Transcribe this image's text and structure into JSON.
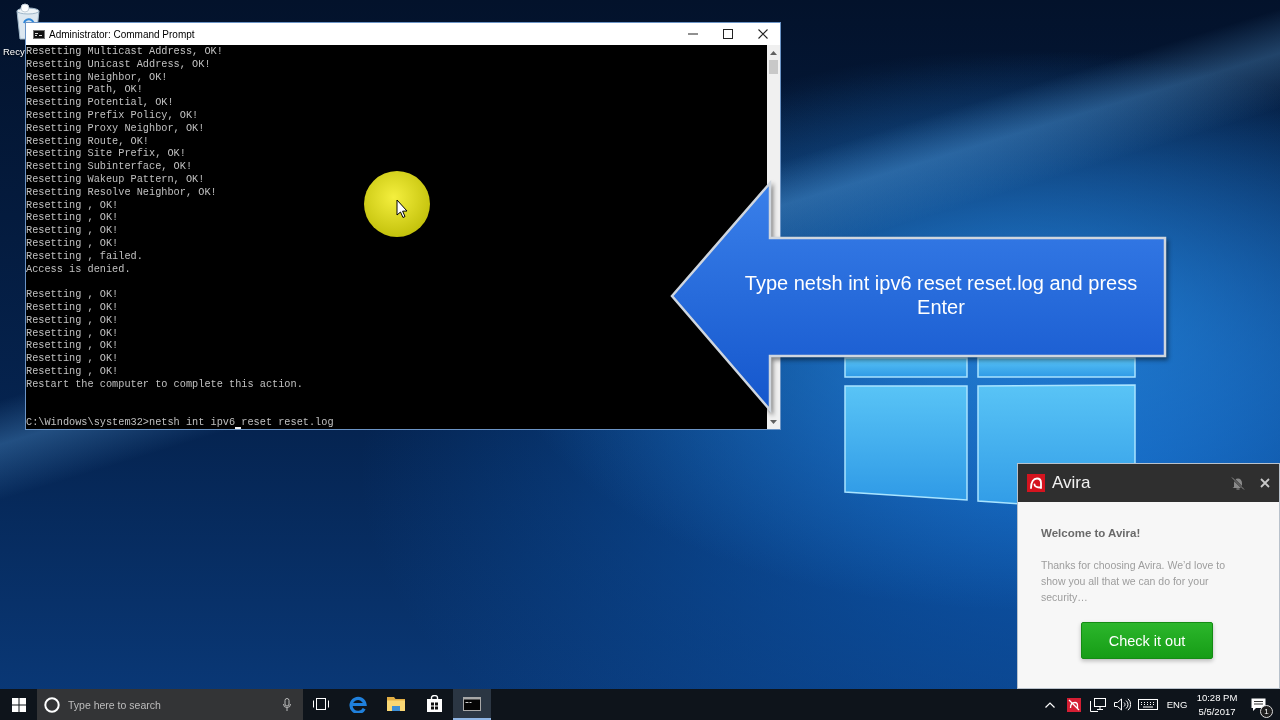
{
  "desktop": {
    "icons": [
      {
        "label": "Recy"
      }
    ]
  },
  "command_prompt": {
    "title": "Administrator: Command Prompt",
    "output_blocks": [
      [
        "Resetting Multicast Address, OK!",
        "Resetting Unicast Address, OK!",
        "Resetting Neighbor, OK!",
        "Resetting Path, OK!",
        "Resetting Potential, OK!",
        "Resetting Prefix Policy, OK!",
        "Resetting Proxy Neighbor, OK!",
        "Resetting Route, OK!",
        "Resetting Site Prefix, OK!",
        "Resetting Subinterface, OK!",
        "Resetting Wakeup Pattern, OK!",
        "Resetting Resolve Neighbor, OK!",
        "Resetting , OK!",
        "Resetting , OK!",
        "Resetting , OK!",
        "Resetting , OK!",
        "Resetting , failed.",
        "Access is denied."
      ],
      [
        "Resetting , OK!",
        "Resetting , OK!",
        "Resetting , OK!",
        "Resetting , OK!",
        "Resetting , OK!",
        "Resetting , OK!",
        "Resetting , OK!",
        "Restart the computer to complete this action."
      ]
    ],
    "command_line": "C:\\Windows\\system32>netsh int ipv6 reset reset.log"
  },
  "callout": {
    "text": "Type netsh int ipv6 reset reset.log and press Enter"
  },
  "avira_popup": {
    "title": "Avira",
    "heading": "Welcome to Avira!",
    "message": "Thanks for choosing Avira. We’d love to show you all that we can do for your security…",
    "button": "Check it out"
  },
  "taskbar": {
    "search": {
      "placeholder": "Type here to search"
    },
    "apps": [
      {
        "kind": "task_view",
        "selected": false
      },
      {
        "kind": "browser",
        "selected": false
      },
      {
        "kind": "file_explorer",
        "selected": false
      },
      {
        "kind": "store",
        "selected": false
      },
      {
        "kind": "command_prompt",
        "selected": true
      }
    ],
    "tray": {
      "language": "ENG",
      "time": "10:28 PM",
      "date": "5/5/2017",
      "notification_count": "1"
    }
  }
}
